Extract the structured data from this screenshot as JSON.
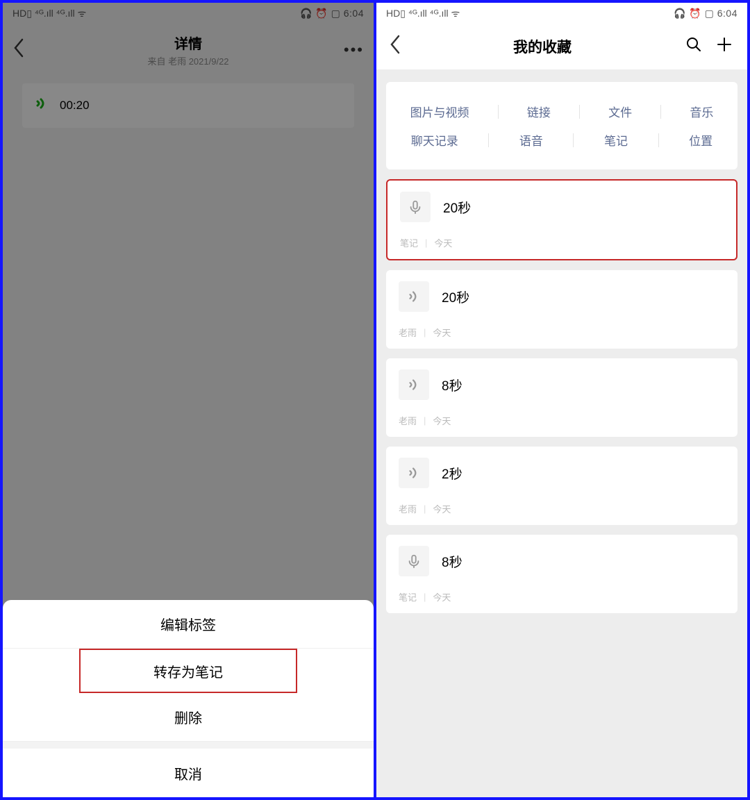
{
  "status": {
    "left_text": "HD▯ ⁴ᴳ.ıll ⁴ᴳ.ıll ᯤ",
    "right_text": "🎧 ⏰ ▢ 6:04",
    "time": "6:04"
  },
  "left": {
    "nav": {
      "title": "详情",
      "subtitle": "来自 老雨 2021/9/22"
    },
    "voice": {
      "duration": "00:20"
    },
    "sheet": {
      "edit_tags": "编辑标签",
      "save_as_note": "转存为笔记",
      "delete": "删除",
      "cancel": "取消"
    }
  },
  "right": {
    "nav": {
      "title": "我的收藏"
    },
    "categories_row1": [
      "图片与视频",
      "链接",
      "文件",
      "音乐"
    ],
    "categories_row2": [
      "聊天记录",
      "语音",
      "笔记",
      "位置"
    ],
    "items": [
      {
        "icon": "mic",
        "title": "20秒",
        "meta1": "笔记",
        "meta2": "今天",
        "highlight": true
      },
      {
        "icon": "sound",
        "title": "20秒",
        "meta1": "老雨",
        "meta2": "今天",
        "highlight": false
      },
      {
        "icon": "sound",
        "title": "8秒",
        "meta1": "老雨",
        "meta2": "今天",
        "highlight": false
      },
      {
        "icon": "sound",
        "title": "2秒",
        "meta1": "老雨",
        "meta2": "今天",
        "highlight": false
      },
      {
        "icon": "mic",
        "title": "8秒",
        "meta1": "笔记",
        "meta2": "今天",
        "highlight": false
      }
    ]
  }
}
